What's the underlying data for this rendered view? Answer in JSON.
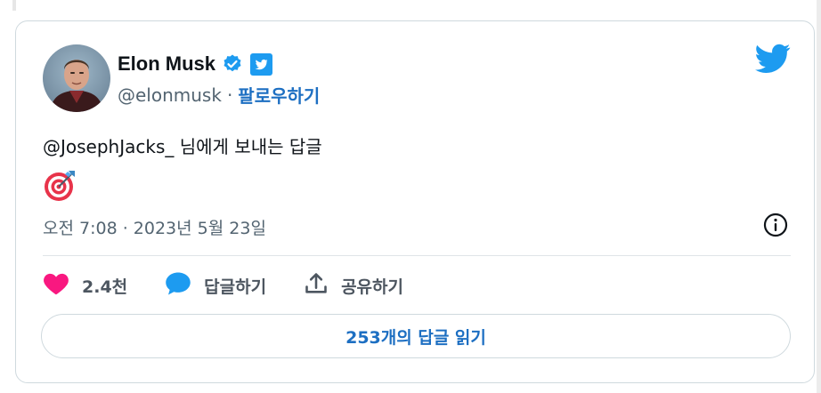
{
  "author": {
    "name": "Elon Musk",
    "handle": "@elonmusk",
    "separator": "·",
    "follow_label": "팔로우하기"
  },
  "tweet": {
    "reply_text": "@JosephJacks_ 님에게 보내는 답글",
    "emoji": "target-emoji",
    "timestamp": "오전 7:08 · 2023년 5월 23일"
  },
  "actions": {
    "like_count": "2.4천",
    "reply_label": "답글하기",
    "share_label": "공유하기"
  },
  "read_replies_label": "253개의 답글 읽기",
  "colors": {
    "twitter_blue": "#1d9bf0",
    "link_blue": "#1d6fc2",
    "like_pink": "#f91880",
    "reply_blue": "#1d9bf0"
  },
  "icons": [
    "verified-badge-icon",
    "twitter-square-icon",
    "twitter-bird-icon",
    "info-icon",
    "heart-icon",
    "speech-bubble-icon",
    "share-icon"
  ]
}
